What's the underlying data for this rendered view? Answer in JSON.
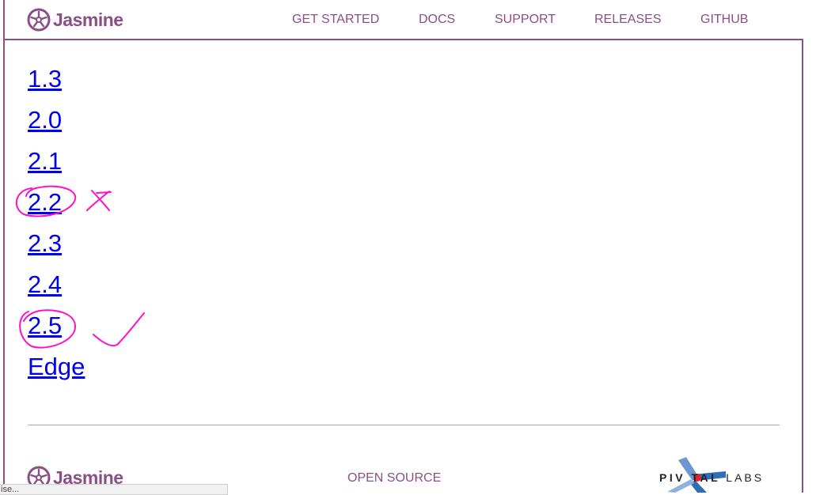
{
  "header": {
    "logo_text": "Jasmine",
    "nav": [
      {
        "label": "GET STARTED"
      },
      {
        "label": "DOCS"
      },
      {
        "label": "SUPPORT"
      },
      {
        "label": "RELEASES"
      },
      {
        "label": "GITHUB"
      }
    ]
  },
  "versions": [
    "1.3",
    "2.0",
    "2.1",
    "2.2",
    "2.3",
    "2.4",
    "2.5",
    "Edge"
  ],
  "footer": {
    "logo_text": "Jasmine",
    "open_source": "OPEN SOURCE",
    "pivotal_main": "PIV TAL",
    "pivotal_labs": "LABS"
  },
  "status_bar": "ise...",
  "colors": {
    "brand": "#8a4f87",
    "link": "#0000ee",
    "annotation": "#ff10c8"
  }
}
